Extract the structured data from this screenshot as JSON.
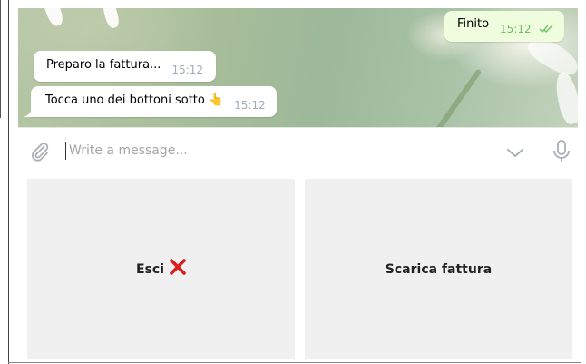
{
  "messages": {
    "outgoing": [
      {
        "text": "Finito",
        "time": "15:12"
      }
    ],
    "incoming": [
      {
        "text": "Preparo la fattura...",
        "time": "15:12"
      },
      {
        "text": "Tocca uno dei bottoni sotto 👆",
        "time": "15:12"
      }
    ]
  },
  "composer": {
    "placeholder": "Write a message..."
  },
  "keyboard": {
    "buttons": [
      {
        "label": "Esci",
        "emoji": "❌"
      },
      {
        "label": "Scarica fattura"
      }
    ]
  },
  "icons": {
    "attach": "paperclip-icon",
    "emoji_toggle": "chevron-down-icon",
    "voice": "microphone-icon",
    "read_receipt": "double-check-icon",
    "exit_mark": "cross-mark-icon"
  },
  "colors": {
    "outgoing_bubble": "#effdde",
    "incoming_bubble": "#ffffff",
    "outgoing_time": "#6cc264",
    "incoming_time": "#a0acb6",
    "keyboard_button": "#f0f0f0",
    "cross_mark": "#dd1a1a"
  }
}
